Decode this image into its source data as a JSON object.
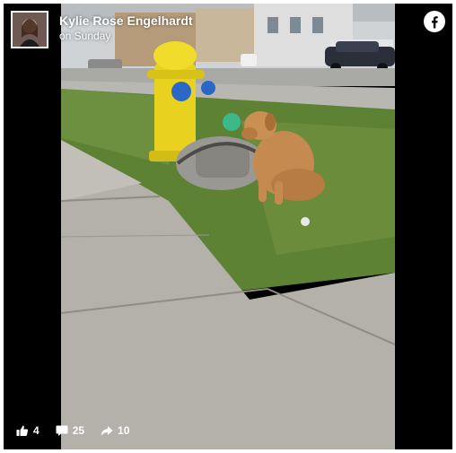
{
  "post": {
    "author_name": "Kylie Rose Engelhardt",
    "timestamp": "on Sunday",
    "avatar_icon": "profile-photo",
    "platform_icon": "facebook-logo-icon",
    "brand_color": "#ffffff",
    "background_color": "#000000"
  },
  "photo": {
    "subject_icon": "photo-dog-tied-to-fire-hydrant"
  },
  "stats": {
    "likes": "4",
    "comments": "25",
    "shares": "10"
  }
}
